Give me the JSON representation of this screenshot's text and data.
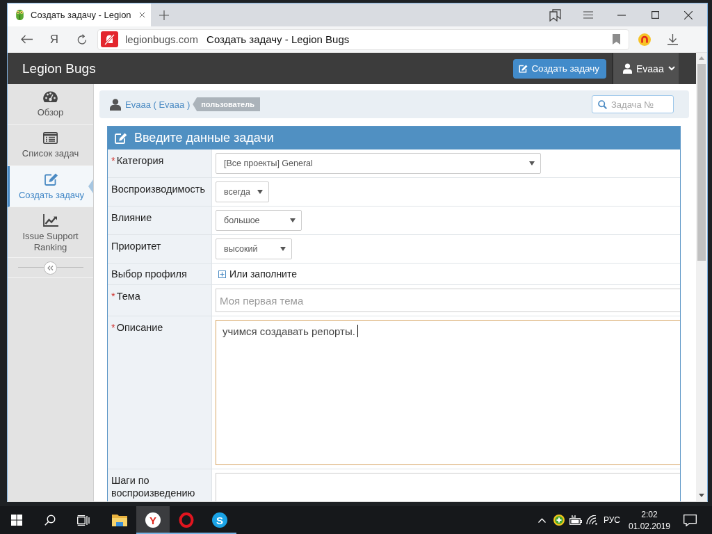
{
  "browser": {
    "tabs": [
      {
        "title": "Создать задачу - Legion",
        "selected": true
      }
    ],
    "home_button": "Я",
    "address_bar": {
      "domain": "legionbugs.com",
      "page_title": "Создать задачу - Legion Bugs"
    }
  },
  "app_header": {
    "brand": "Legion Bugs",
    "create_button": "Создать задачу",
    "user_menu": "Evaaa"
  },
  "sidebar": {
    "items": [
      {
        "label": "Обзор",
        "selected": false
      },
      {
        "label": "Список задач",
        "selected": false
      },
      {
        "label": "Создать задачу",
        "selected": true
      },
      {
        "label": "Issue Support Ranking",
        "selected": false
      }
    ]
  },
  "user_bar": {
    "user": "Evaaa ( Evaaa )",
    "role": "пользователь"
  },
  "search": {
    "placeholder": "Задача №"
  },
  "form": {
    "title": "Введите данные задачи",
    "fields": [
      {
        "kind": "select",
        "label": "Категория",
        "required_mark": "*",
        "value": "[Все проекты] General"
      },
      {
        "kind": "select",
        "label": "Воспроизводимость",
        "value": "всегда"
      },
      {
        "kind": "select",
        "label": "Влияние",
        "value": "большое"
      },
      {
        "kind": "select",
        "label": "Приоритет",
        "value": "высокий"
      },
      {
        "kind": "link",
        "label": "Выбор профиля",
        "link": "Или заполните"
      },
      {
        "kind": "text",
        "label": "Тема",
        "required_mark": "*",
        "placeholder": "Моя первая тема"
      },
      {
        "kind": "textarea",
        "label": "Описание",
        "required_mark": "*",
        "value": "учимся создавать репорты.",
        "focused": true
      },
      {
        "kind": "textarea",
        "label": "Шаги по воспроизведению",
        "focused": false
      }
    ]
  },
  "taskbar": {
    "apps": [
      {
        "kind": "folder",
        "running": false,
        "selected": false
      },
      {
        "kind": "logo",
        "glyph": "Y",
        "running": true,
        "selected": true
      },
      {
        "kind": "ring",
        "running": true,
        "selected": false
      },
      {
        "kind": "logo",
        "glyph": "S",
        "running": true,
        "selected": false
      }
    ],
    "language": "РУС",
    "time": "2:02",
    "date": "01.02.2019"
  }
}
